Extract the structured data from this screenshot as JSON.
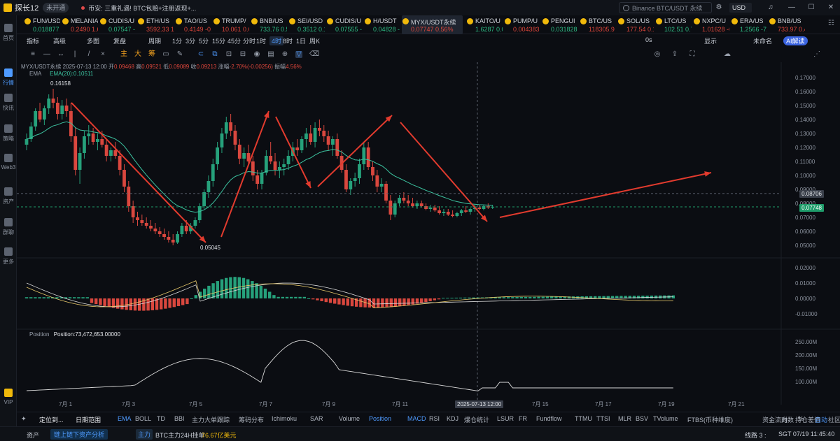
{
  "window": {
    "app_name": "探长12",
    "status_badge": "未开通",
    "news": "币安: 三重礼遇! BTC包赔+注册返现+...",
    "search_placeholder": "Binance BTC/USDT 永续",
    "currency": "USD"
  },
  "sidebar": [
    {
      "label": "首页"
    },
    {
      "label": "行情"
    },
    {
      "label": "快讯"
    },
    {
      "label": "策略"
    },
    {
      "label": "Web3"
    },
    {
      "label": "资产"
    },
    {
      "label": "群聊"
    },
    {
      "label": "更多"
    },
    {
      "label": "VIP"
    }
  ],
  "tickers": [
    {
      "sym": "FUN/USDT",
      "price": "0.018877",
      "color": "#2ebd85",
      "dot": "#f0b90b"
    },
    {
      "sym": "MELANIA",
      "price": "0.2490 1.6",
      "color": "#e0473c",
      "dot": "#f0b90b"
    },
    {
      "sym": "CUDIS/U",
      "price": "0.07547 -",
      "color": "#2ebd85",
      "dot": "#f0b90b"
    },
    {
      "sym": "ETH/US",
      "price": "3592.33 1",
      "color": "#e0473c",
      "dot": "#f0b90b"
    },
    {
      "sym": "TAO/US",
      "price": "0.4149 -0.",
      "color": "#e0473c",
      "dot": "#f0b90b"
    },
    {
      "sym": "TRUMP/",
      "price": "10.061 0.6",
      "color": "#e0473c",
      "dot": "#f0b90b"
    },
    {
      "sym": "BNB/US",
      "price": "733.76 0.5",
      "color": "#2ebd85",
      "dot": "#f0b90b"
    },
    {
      "sym": "SEI/USD",
      "price": "0.3512 0.1",
      "color": "#2ebd85",
      "dot": "#f0b90b"
    },
    {
      "sym": "CUDIS/U",
      "price": "0.07555 -",
      "color": "#2ebd85",
      "dot": "#f0b90b"
    },
    {
      "sym": "H/USDT",
      "price": "0.04828 -",
      "color": "#2ebd85",
      "dot": "#f0b90b"
    },
    {
      "sym": "MYX/USDT永续",
      "price": "0.07747 0.56%",
      "color": "#e0473c",
      "dot": "#f0b90b",
      "active": true
    },
    {
      "sym": "KAITO/U",
      "price": "1.6287 0.0",
      "color": "#2ebd85",
      "dot": "#f0b90b"
    },
    {
      "sym": "PUMP/U",
      "price": "0.004383 -",
      "color": "#e0473c",
      "dot": "#f0b90b"
    },
    {
      "sym": "PENGUI",
      "price": "0.031828",
      "color": "#2ebd85",
      "dot": "#f0b90b"
    },
    {
      "sym": "BTC/US",
      "price": "118305.9",
      "color": "#e0473c",
      "dot": "#f0b90b"
    },
    {
      "sym": "SOL/US",
      "price": "177.54 0.1",
      "color": "#e0473c",
      "dot": "#f0b90b"
    },
    {
      "sym": "LTC/US",
      "price": "102.51 0.7",
      "color": "#2ebd85",
      "dot": "#f0b90b"
    },
    {
      "sym": "NXPC/U",
      "price": "1.01628 -0",
      "color": "#e0473c",
      "dot": "#f0b90b"
    },
    {
      "sym": "ERA/US",
      "price": "1.2566 -7.",
      "color": "#2ebd85",
      "dot": "#f0b90b"
    },
    {
      "sym": "BNB/US",
      "price": "733.97 0.4",
      "color": "#e0473c",
      "dot": "#f0b90b"
    }
  ],
  "toolbar": {
    "indicators": "指标",
    "advanced": "高级",
    "multi": "多图",
    "replay": "复盘",
    "period": "周期",
    "intervals": [
      "1分",
      "3分",
      "5分",
      "15分",
      "45分",
      "分时",
      "1时",
      "4时",
      "8时",
      "1日",
      "周K"
    ],
    "active_interval": "4时",
    "right_items": [
      "0s",
      "显示",
      "未命名",
      "AI解读"
    ]
  },
  "chart_labels": {
    "title": "MYX/USDT永续",
    "datetime": "2025-07-13 12:00",
    "open_label": "开",
    "open": "0.09468",
    "high_label": "高",
    "high": "0.09521",
    "low_label": "低",
    "low": "0.09089",
    "close_label": "收",
    "close": "0.09213",
    "change_label": "涨幅",
    "change": "-2.70%(-0.00256)",
    "amplitude_label": "振幅",
    "amplitude": "4.56%",
    "ema_name": "EMA",
    "ema_value": "EMA(20):0.10511",
    "high_marker": "0.16158",
    "low_marker": "0.05045",
    "tag_hover": "0.08706",
    "tag_last": "0.07748",
    "position_name": "Position",
    "position_value": "Position:73,472,653.00000",
    "crosshair_time": "2025-07-13 12:00",
    "price_ticks": [
      "0.17000",
      "0.16000",
      "0.15000",
      "0.14000",
      "0.13000",
      "0.12000",
      "0.11000",
      "0.10000",
      "0.09000",
      "0.08000",
      "0.07000",
      "0.06000",
      "0.05000"
    ],
    "macd_ticks": [
      "0.02000",
      "0.01000",
      "0.00000",
      "-0.01000"
    ],
    "pos_ticks": [
      "250.00M",
      "200.00M",
      "150.00M",
      "100.00M"
    ],
    "date_ticks": [
      "7月 1",
      "7月 3",
      "7月 5",
      "7月 7",
      "7月 9",
      "7月 11",
      "7月 15",
      "7月 17",
      "7月 19",
      "7月 21"
    ]
  },
  "bottombar": {
    "left": [
      "定位到...",
      "日期范围"
    ],
    "indicators_main": [
      "EMA",
      "BOLL",
      "TD",
      "BBI",
      "主力大单跟踪",
      "筹码分布",
      "Ichimoku",
      "SAR"
    ],
    "indicators_sub": [
      "Volume",
      "Position",
      "MACD",
      "RSI",
      "KDJ",
      "爆仓统计",
      "LSUR",
      "FR",
      "Fundflow",
      "TTMU",
      "TTSI",
      "MLR",
      "BSV",
      "TVolume",
      "FTBS(币种维度)",
      "资金流向",
      "持仓差值",
      "社区指标"
    ],
    "right": [
      "对数",
      "%",
      "自动"
    ],
    "active": [
      "EMA",
      "Position",
      "MACD"
    ]
  },
  "statusbar": {
    "assets": "资产",
    "analysis": "链上链下资产分析",
    "main_tag": "主力",
    "btc_text": "BTC主力24H挂单",
    "btc_value": "76.67亿美元",
    "line": "线路 3 :",
    "time": "SGT 07/19 11:45:40"
  },
  "chart_data": {
    "type": "candlestick",
    "title": "MYX/USDT永续",
    "interval": "4时",
    "y_range": [
      0.045,
      0.175
    ],
    "x_axis": [
      "7月 1",
      "7月 3",
      "7月 5",
      "7月 7",
      "7月 9",
      "7月 11",
      "7月 13",
      "7月 15",
      "7月 17",
      "7月 19",
      "7月 21"
    ],
    "ema20": {
      "name": "EMA(20)",
      "last": 0.10511
    },
    "annotations": {
      "high": 0.16158,
      "low": 0.05045,
      "arrows": 5
    },
    "candles": [
      [
        0.122,
        0.13,
        0.118,
        0.126
      ],
      [
        0.126,
        0.138,
        0.124,
        0.135
      ],
      [
        0.135,
        0.148,
        0.132,
        0.146
      ],
      [
        0.146,
        0.152,
        0.138,
        0.14
      ],
      [
        0.14,
        0.15,
        0.136,
        0.148
      ],
      [
        0.148,
        0.158,
        0.144,
        0.155
      ],
      [
        0.155,
        0.162,
        0.148,
        0.152
      ],
      [
        0.152,
        0.156,
        0.14,
        0.144
      ],
      [
        0.144,
        0.154,
        0.14,
        0.15
      ],
      [
        0.15,
        0.155,
        0.142,
        0.146
      ],
      [
        0.146,
        0.152,
        0.124,
        0.128
      ],
      [
        0.128,
        0.134,
        0.1,
        0.104
      ],
      [
        0.104,
        0.12,
        0.094,
        0.116
      ],
      [
        0.116,
        0.132,
        0.112,
        0.128
      ],
      [
        0.128,
        0.136,
        0.122,
        0.13
      ],
      [
        0.13,
        0.134,
        0.122,
        0.124
      ],
      [
        0.124,
        0.13,
        0.118,
        0.126
      ],
      [
        0.126,
        0.132,
        0.12,
        0.122
      ],
      [
        0.122,
        0.126,
        0.11,
        0.114
      ],
      [
        0.114,
        0.12,
        0.11,
        0.118
      ],
      [
        0.118,
        0.124,
        0.112,
        0.114
      ],
      [
        0.114,
        0.118,
        0.1,
        0.104
      ],
      [
        0.104,
        0.108,
        0.088,
        0.092
      ],
      [
        0.092,
        0.096,
        0.074,
        0.078
      ],
      [
        0.078,
        0.082,
        0.066,
        0.07
      ],
      [
        0.07,
        0.074,
        0.064,
        0.068
      ],
      [
        0.068,
        0.072,
        0.064,
        0.066
      ],
      [
        0.066,
        0.07,
        0.062,
        0.064
      ],
      [
        0.064,
        0.068,
        0.06,
        0.062
      ],
      [
        0.062,
        0.066,
        0.058,
        0.06
      ],
      [
        0.06,
        0.063,
        0.056,
        0.058
      ],
      [
        0.058,
        0.062,
        0.054,
        0.056
      ],
      [
        0.056,
        0.06,
        0.052,
        0.054
      ],
      [
        0.054,
        0.058,
        0.05,
        0.052
      ],
      [
        0.052,
        0.06,
        0.051,
        0.058
      ],
      [
        0.058,
        0.066,
        0.056,
        0.064
      ],
      [
        0.064,
        0.068,
        0.058,
        0.06
      ],
      [
        0.06,
        0.066,
        0.058,
        0.064
      ],
      [
        0.064,
        0.07,
        0.062,
        0.068
      ],
      [
        0.068,
        0.08,
        0.066,
        0.078
      ],
      [
        0.078,
        0.09,
        0.076,
        0.088
      ],
      [
        0.088,
        0.1,
        0.084,
        0.096
      ],
      [
        0.096,
        0.112,
        0.092,
        0.108
      ],
      [
        0.108,
        0.124,
        0.104,
        0.12
      ],
      [
        0.12,
        0.134,
        0.116,
        0.13
      ],
      [
        0.13,
        0.142,
        0.126,
        0.138
      ],
      [
        0.138,
        0.144,
        0.128,
        0.132
      ],
      [
        0.132,
        0.136,
        0.118,
        0.122
      ],
      [
        0.122,
        0.126,
        0.108,
        0.112
      ],
      [
        0.112,
        0.12,
        0.106,
        0.116
      ],
      [
        0.116,
        0.122,
        0.108,
        0.11
      ],
      [
        0.11,
        0.114,
        0.096,
        0.1
      ],
      [
        0.1,
        0.104,
        0.09,
        0.094
      ],
      [
        0.094,
        0.104,
        0.09,
        0.102
      ],
      [
        0.102,
        0.118,
        0.1,
        0.114
      ],
      [
        0.114,
        0.124,
        0.108,
        0.11
      ],
      [
        0.11,
        0.116,
        0.1,
        0.104
      ],
      [
        0.104,
        0.11,
        0.098,
        0.106
      ],
      [
        0.106,
        0.112,
        0.1,
        0.108
      ],
      [
        0.108,
        0.118,
        0.104,
        0.114
      ],
      [
        0.114,
        0.124,
        0.11,
        0.12
      ],
      [
        0.12,
        0.126,
        0.114,
        0.118
      ],
      [
        0.118,
        0.128,
        0.116,
        0.126
      ],
      [
        0.126,
        0.134,
        0.12,
        0.13
      ],
      [
        0.13,
        0.136,
        0.122,
        0.124
      ],
      [
        0.124,
        0.138,
        0.12,
        0.134
      ],
      [
        0.134,
        0.14,
        0.128,
        0.132
      ],
      [
        0.132,
        0.136,
        0.124,
        0.128
      ],
      [
        0.128,
        0.132,
        0.118,
        0.122
      ],
      [
        0.122,
        0.128,
        0.114,
        0.126
      ],
      [
        0.126,
        0.13,
        0.112,
        0.114
      ],
      [
        0.114,
        0.118,
        0.102,
        0.104
      ],
      [
        0.104,
        0.108,
        0.088,
        0.09
      ],
      [
        0.09,
        0.098,
        0.086,
        0.096
      ],
      [
        0.096,
        0.102,
        0.092,
        0.098
      ],
      [
        0.098,
        0.112,
        0.094,
        0.108
      ],
      [
        0.108,
        0.124,
        0.104,
        0.12
      ],
      [
        0.12,
        0.124,
        0.104,
        0.106
      ],
      [
        0.106,
        0.11,
        0.096,
        0.1
      ],
      [
        0.1,
        0.104,
        0.088,
        0.092
      ],
      [
        0.092,
        0.098,
        0.088,
        0.094
      ],
      [
        0.094,
        0.096,
        0.08,
        0.082
      ],
      [
        0.082,
        0.086,
        0.068,
        0.072
      ],
      [
        0.072,
        0.082,
        0.07,
        0.08
      ],
      [
        0.08,
        0.086,
        0.078,
        0.084
      ],
      [
        0.084,
        0.088,
        0.08,
        0.082
      ],
      [
        0.082,
        0.086,
        0.078,
        0.08
      ],
      [
        0.08,
        0.084,
        0.077,
        0.078
      ],
      [
        0.078,
        0.082,
        0.076,
        0.08
      ],
      [
        0.08,
        0.082,
        0.077,
        0.078
      ],
      [
        0.078,
        0.08,
        0.075,
        0.076
      ],
      [
        0.076,
        0.079,
        0.074,
        0.077
      ],
      [
        0.077,
        0.079,
        0.074,
        0.075
      ],
      [
        0.075,
        0.078,
        0.072,
        0.073
      ],
      [
        0.073,
        0.076,
        0.071,
        0.074
      ],
      [
        0.074,
        0.076,
        0.071,
        0.072
      ],
      [
        0.072,
        0.075,
        0.07,
        0.071
      ],
      [
        0.071,
        0.074,
        0.07,
        0.073
      ],
      [
        0.073,
        0.076,
        0.071,
        0.075
      ],
      [
        0.075,
        0.078,
        0.073,
        0.074
      ],
      [
        0.074,
        0.077,
        0.072,
        0.076
      ],
      [
        0.076,
        0.079,
        0.074,
        0.077
      ],
      [
        0.077,
        0.079,
        0.075,
        0.076
      ],
      [
        0.076,
        0.079,
        0.075,
        0.078
      ],
      [
        0.078,
        0.08,
        0.076,
        0.077
      ],
      [
        0.077,
        0.079,
        0.076,
        0.0775
      ]
    ]
  }
}
